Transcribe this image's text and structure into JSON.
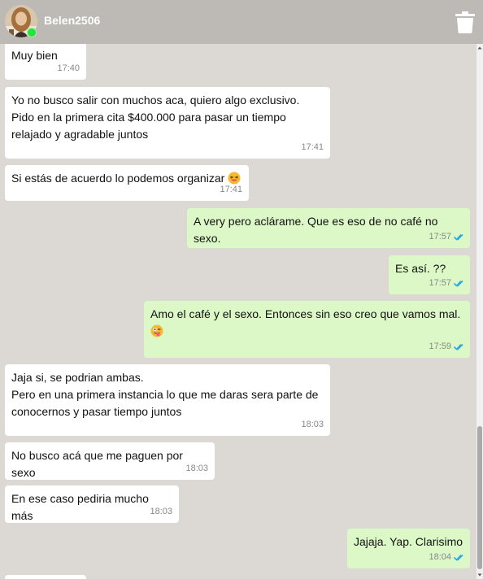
{
  "contact": {
    "name": "Belen2506",
    "status": "online"
  },
  "colors": {
    "header": "#bdbab6",
    "background": "#dcd8d4",
    "incoming": "#ffffff",
    "outgoing": "#dcf8c6",
    "tick": "#29a9e6",
    "online": "#22e53a"
  },
  "icons": {
    "delete": "trash-icon",
    "read_receipt": "double-check-icon"
  },
  "messages": [
    {
      "direction": "in",
      "text": "Muy bien",
      "time": "17:40"
    },
    {
      "direction": "in",
      "lines": [
        "Yo no busco salir con muchos aca, quiero algo exclusivo.",
        "Pido en la primera cita $400.000 para pasar un tiempo",
        "relajado y agradable juntos"
      ],
      "time": "17:41"
    },
    {
      "direction": "in",
      "text": "Si estás de acuerdo lo podemos organizar",
      "emoji": "grinning-squinting-face",
      "time": "17:41"
    },
    {
      "direction": "out",
      "text": "A very pero aclárame. Que es eso de no café no sexo.",
      "time": "17:57"
    },
    {
      "direction": "out",
      "text": "Es así. ??",
      "time": "17:57"
    },
    {
      "direction": "out",
      "text": "Amo el café y el sexo. Entonces sin eso creo que vamos mal.",
      "emoji": "winking-tongue-face",
      "time": "17:59"
    },
    {
      "direction": "in",
      "lines": [
        "Jaja si, se podrian ambas.",
        "Pero en una primera instancia lo que me daras sera parte de",
        "conocernos y pasar tiempo juntos"
      ],
      "time": "18:03"
    },
    {
      "direction": "in",
      "text": "No busco acá que me paguen por sexo",
      "time": "18:03"
    },
    {
      "direction": "in",
      "text": "En ese caso pediria mucho más",
      "time": "18:03"
    },
    {
      "direction": "out",
      "text": "Jajaja. Yap. Clarisimo",
      "time": "18:04"
    }
  ]
}
